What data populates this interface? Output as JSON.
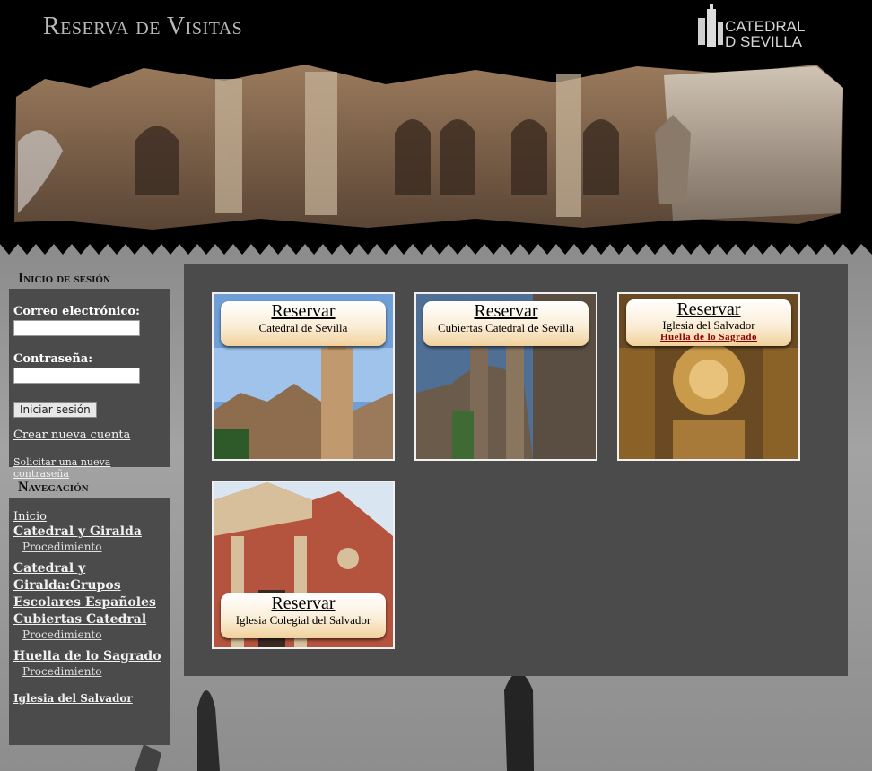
{
  "header": {
    "site_title": "Reserva de Visitas",
    "logo_text_line1": "CATEDRAL",
    "logo_text_line2": "D SEVILLA"
  },
  "login": {
    "title": "Inicio de sesión",
    "email_label": "Correo electrónico:",
    "password_label": "Contraseña:",
    "submit_label": "Iniciar sesión",
    "create_account": "Crear nueva cuenta",
    "request_password": "Solicitar una nueva contraseña"
  },
  "navigation": {
    "title": "Navegación",
    "home": "Inicio",
    "item1": "Catedral y Giralda",
    "item1_sub": "Procedimiento",
    "item2": "Catedral y Giralda:Grupos Escolares Españoles",
    "item3": "Cubiertas Catedral",
    "item3_sub": "Procedimiento",
    "item4": "Huella de lo Sagrado",
    "item4_sub": "Procedimiento",
    "item5": "Iglesia del Salvador"
  },
  "tiles": [
    {
      "action": "Reservar",
      "label": "Catedral de Sevilla"
    },
    {
      "action": "Reservar",
      "label": "Cubiertas Catedral de Sevilla"
    },
    {
      "action": "Reservar",
      "label": "Iglesia del Salvador",
      "highlight": "Huella de lo Sagrado"
    },
    {
      "action": "Reservar",
      "label": "Iglesia Colegial del Salvador"
    }
  ],
  "colors": {
    "panel": "#4b4b4b",
    "accent_red": "#8a0000",
    "pill_gold": "#f1d19c"
  }
}
